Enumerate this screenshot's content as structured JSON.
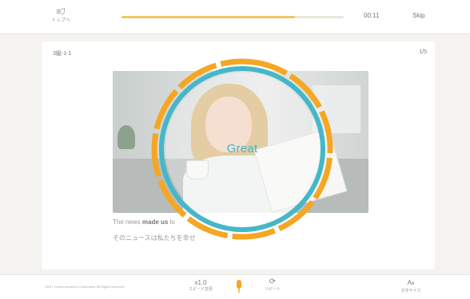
{
  "header": {
    "menu_icon": "menu-lines-icon",
    "menu_glyph": "≡ℐ",
    "menu_label": "トップへ",
    "progress": 0.78,
    "progress_color": "#f1c56b",
    "timer": "00:11",
    "skip_label": "Skip"
  },
  "lesson": {
    "id": "3級-1-1",
    "page": "1/5",
    "sentence_pre": "The news ",
    "sentence_bold": "made us",
    "sentence_post": " lo",
    "translation": "そのニュースは私たちを幸せ"
  },
  "result": {
    "verdict": "Great",
    "accent_teal": "#45b7c8",
    "accent_orange": "#f5a623"
  },
  "footer": {
    "copyright": "SANT Communications Corporation All Rights Reserved.",
    "speed_value": "x1.0",
    "speed_label": "スピード変更",
    "mic_icon": "microphone-icon",
    "mic_color": "#f5a623",
    "repeat_icon": "repeat-icon",
    "repeat_glyph": "⟳",
    "repeat_label": "リピート",
    "textsize_glyph": "A",
    "textsize_glyph_small": "A",
    "textsize_label": "文字サイズ"
  }
}
